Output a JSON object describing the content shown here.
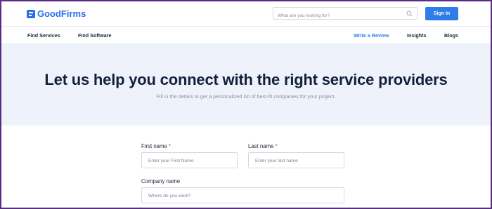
{
  "brand": {
    "name": "GoodFirms"
  },
  "search": {
    "placeholder": "What are you looking for?"
  },
  "header": {
    "signin_label": "Sign In"
  },
  "nav": {
    "left": [
      "Find Services",
      "Find Software"
    ],
    "right": [
      "Write a Review",
      "Insights",
      "Blogs"
    ],
    "active": "Write a Review"
  },
  "hero": {
    "title": "Let us help you connect with the right service providers",
    "subtitle": "Fill in the details to get a personalized list of best-fit companies for your project."
  },
  "form": {
    "first_name": {
      "label": "First name",
      "required_mark": "*",
      "placeholder": "Enter your First Name"
    },
    "last_name": {
      "label": "Last name",
      "required_mark": "*",
      "placeholder": "Enter your last name"
    },
    "company": {
      "label": "Company name",
      "placeholder": "Where do you work?"
    }
  },
  "colors": {
    "accent": "#2f7de8",
    "heading": "#14213d",
    "hero_bg": "#eef3fb",
    "required": "#e53935",
    "frame": "#5b2a86"
  }
}
